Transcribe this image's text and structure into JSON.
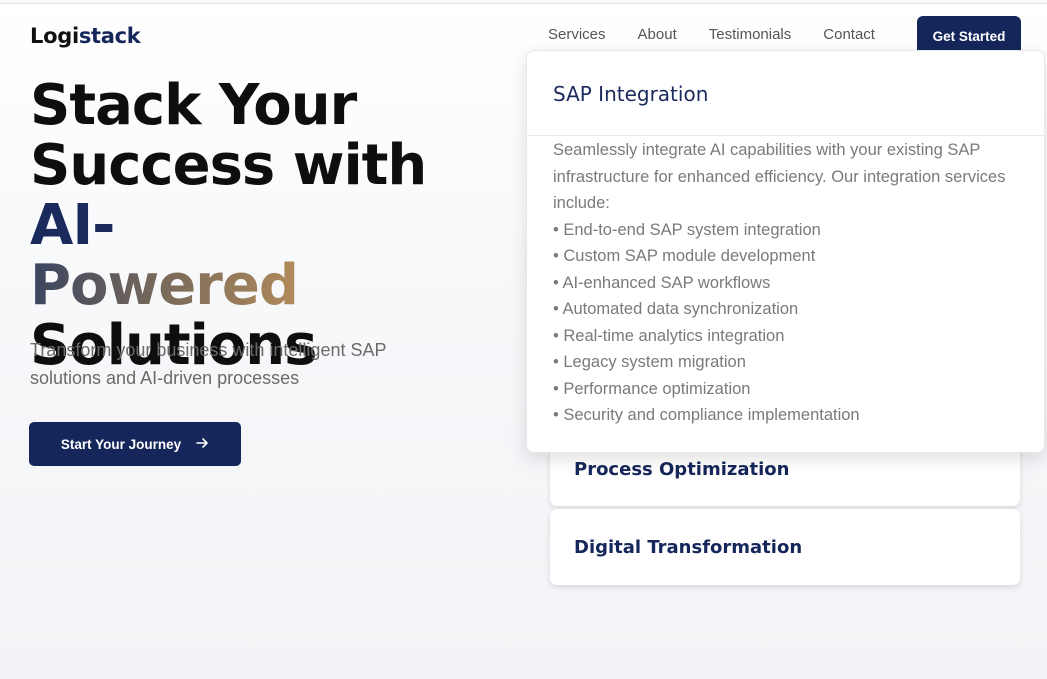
{
  "brand": {
    "part1": "Logi",
    "part2": "stack"
  },
  "nav": {
    "items": [
      "Services",
      "About",
      "Testimonials",
      "Contact"
    ],
    "cta": "Get Started"
  },
  "hero": {
    "line1": "Stack Your",
    "line2a": "Success with ",
    "line2b": "AI-",
    "line3": "Powered",
    "line4": "Solutions",
    "subtitle": "Transform your business with intelligent SAP solutions and AI-driven processes",
    "cta": "Start Your Journey"
  },
  "services": {
    "expanded": {
      "title": "SAP Integration",
      "description": "Seamlessly integrate AI capabilities with your existing SAP infrastructure for enhanced efficiency. Our integration services include:",
      "features": [
        "End-to-end SAP system integration",
        "Custom SAP module development",
        "AI-enhanced SAP workflows",
        "Automated data synchronization",
        "Real-time analytics integration",
        "Legacy system migration",
        "Performance optimization",
        "Security and compliance implementation"
      ]
    },
    "cards": [
      "Process Optimization",
      "Digital Transformation"
    ]
  },
  "colors": {
    "brand_navy": "#15275a",
    "accent_bronze": "#b08a5a"
  },
  "icons": {
    "journey_cta": "arrow-right-icon"
  }
}
